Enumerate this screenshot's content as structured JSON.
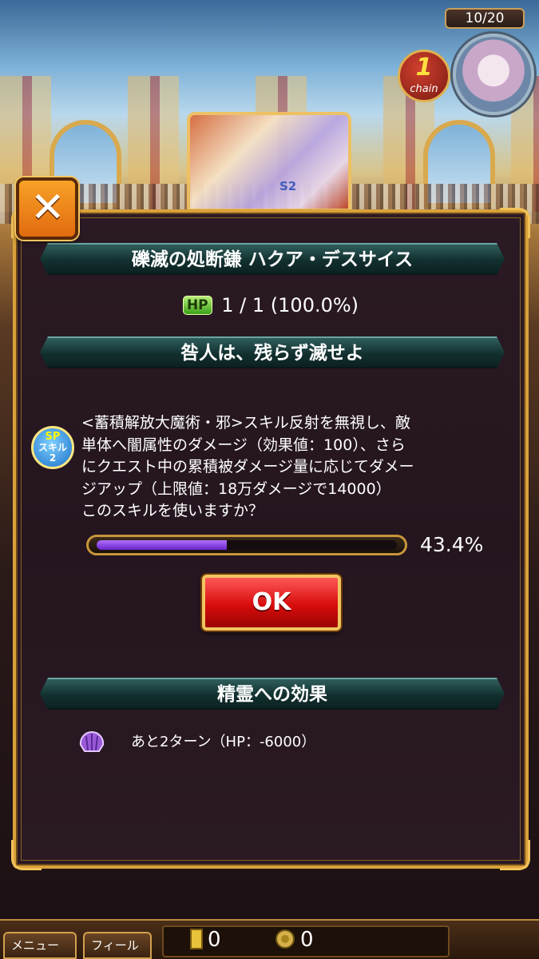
{
  "hud": {
    "stamina_counter": "10/20",
    "chain_count": "1",
    "chain_label": "chain"
  },
  "unit_card": {
    "badge": "S2"
  },
  "dialog": {
    "close_label": "✕",
    "unit_name": "礫滅の処断鎌 ハクア・デスサイス",
    "hp_badge": "HP",
    "hp_value": "1 / 1 (100.0%)",
    "skill_name": "咎人は、残らず滅せよ",
    "sp_icon": {
      "line1": "SP",
      "line2": "スキル",
      "line3": "2"
    },
    "description_lines": [
      "<蓄積解放大魔術・邪>スキル反射を無視し、敵",
      "単体へ闇属性のダメージ（効果値：100）、さら",
      "にクエスト中の累積被ダメージ量に応じてダメー",
      "ジアップ（上限値：18万ダメージで14000）",
      "このスキルを使いますか？"
    ],
    "gauge_percent_label": "43.4%",
    "gauge_fraction": 0.434,
    "ok_label": "OK",
    "effect_header": "精霊への効果",
    "effect_icon": "shell-icon",
    "effect_text": "あと2ターン（HP：-6000）"
  },
  "bottom_bar": {
    "menu_label": "メニュー",
    "field_label": "フィールド",
    "resource1_value": "0",
    "resource2_value": "0"
  },
  "colors": {
    "dialog_border": "#d9a13a",
    "banner_teal": "#12302f",
    "gauge_fill": "#8a40e8",
    "ok_red": "#d80c0c"
  }
}
